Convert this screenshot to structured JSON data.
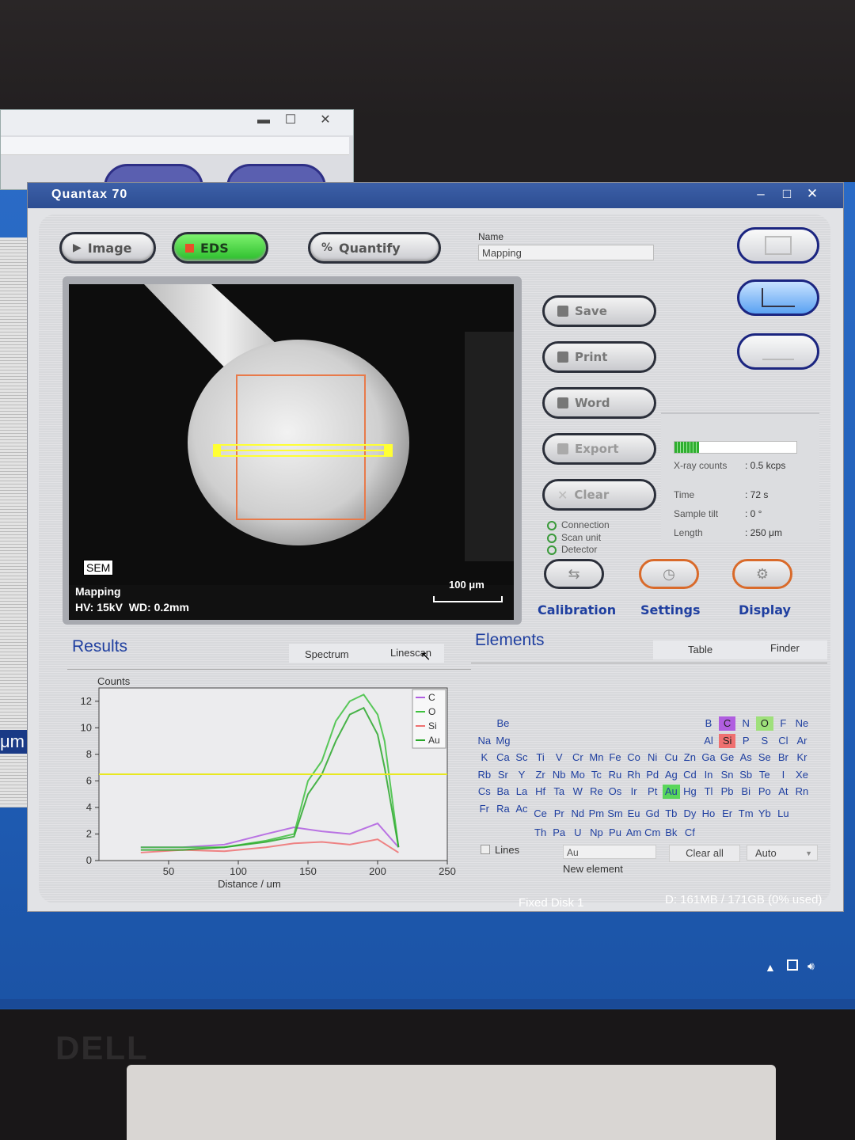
{
  "window": {
    "title": "Quantax 70",
    "min": "–",
    "max": "□",
    "close": "✕"
  },
  "back_window": {
    "min": "▬",
    "max": "☐",
    "close": "✕"
  },
  "left_strip": {
    "unit": "μm"
  },
  "mode_buttons": [
    {
      "label": "Image",
      "icon": "play-triangle-icon"
    },
    {
      "label": "EDS",
      "icon": "stop-square-icon"
    },
    {
      "label": "Quantify",
      "icon": "percent-icon"
    }
  ],
  "name_field": {
    "label": "Name",
    "value": "Mapping"
  },
  "sem_view": {
    "badge": "SEM",
    "mode": "Mapping",
    "params": "HV: 15kV  WD: 0.2mm",
    "scale_label": "100 μm"
  },
  "actions": [
    {
      "label": "Save",
      "icon": "floppy-icon"
    },
    {
      "label": "Print",
      "icon": "printer-icon"
    },
    {
      "label": "Word",
      "icon": "word-doc-icon"
    },
    {
      "label": "Export",
      "icon": "export-icon"
    },
    {
      "label": "Clear",
      "icon": "clear-x-icon"
    }
  ],
  "status": {
    "items": [
      "Connection",
      "Scan unit",
      "Detector"
    ]
  },
  "acquisition": {
    "progress": 0.2,
    "rows": [
      {
        "label": "X-ray counts",
        "value": ": 0.5 kcps"
      },
      {
        "label": "Time",
        "value": ": 72 s"
      },
      {
        "label": "Sample tilt",
        "value": ": 0 °"
      },
      {
        "label": "Length",
        "value": ": 250 μm"
      }
    ]
  },
  "bottom_tools": [
    {
      "label": "Calibration",
      "icon": "calibration-icon"
    },
    {
      "label": "Settings",
      "icon": "clock-icon"
    },
    {
      "label": "Display",
      "icon": "gear-icon"
    }
  ],
  "results": {
    "title": "Results",
    "tabs": [
      "Spectrum",
      "Linescan"
    ]
  },
  "elements_panel": {
    "title": "Elements",
    "tabs": [
      "Table",
      "Finder"
    ],
    "lines_label": "Lines",
    "element_input": "Au",
    "new_element": "New element",
    "clear_all": "Clear all",
    "auto": "Auto"
  },
  "taskbar": {
    "disk": "Fixed Disk 1",
    "usage": "D: 161MB / 171GB (0% used)"
  },
  "colors": {
    "accent_blue": "#1f3fa0",
    "eds_green": "#29bc2a",
    "C": "#b05ee0",
    "O": "#9fe07b",
    "Si": "#ef7070",
    "Au": "#59d65a"
  },
  "chart_data": {
    "type": "line",
    "xlabel": "Distance / μm",
    "ylabel": "Counts",
    "xlim": [
      0,
      250
    ],
    "ylim": [
      0,
      13
    ],
    "xticks": [
      50,
      100,
      150,
      200,
      250
    ],
    "yticks": [
      0,
      2,
      4,
      6,
      8,
      10,
      12
    ],
    "legend": {
      "placement": "top-right",
      "entries": [
        "C",
        "O",
        "Si",
        "Au"
      ]
    },
    "marker_line_y": 6.5,
    "series": [
      {
        "name": "C",
        "x": [
          30,
          60,
          90,
          120,
          140,
          160,
          180,
          200,
          215
        ],
        "values": [
          1,
          1,
          1.2,
          2,
          2.5,
          2.2,
          2,
          2.8,
          1
        ]
      },
      {
        "name": "O",
        "x": [
          30,
          60,
          90,
          120,
          140,
          150,
          160,
          170,
          180,
          190,
          200,
          205,
          215
        ],
        "values": [
          1,
          1,
          1,
          1.5,
          2,
          6,
          7.5,
          10.5,
          12,
          12.5,
          11,
          9,
          1
        ]
      },
      {
        "name": "Si",
        "x": [
          30,
          60,
          90,
          120,
          140,
          160,
          180,
          200,
          215
        ],
        "values": [
          0.6,
          0.8,
          0.7,
          1,
          1.3,
          1.4,
          1.2,
          1.6,
          0.6
        ]
      },
      {
        "name": "Au",
        "x": [
          30,
          60,
          90,
          120,
          140,
          150,
          160,
          170,
          180,
          190,
          200,
          205,
          215
        ],
        "values": [
          0.8,
          0.8,
          1,
          1.4,
          1.8,
          5,
          6.5,
          9,
          11,
          11.5,
          9.5,
          7,
          1
        ]
      }
    ]
  },
  "periodic": [
    {
      "s": "Be",
      "c": 1,
      "r": 1
    },
    {
      "s": "B",
      "c": 12,
      "r": 1
    },
    {
      "s": "C",
      "c": 13,
      "r": 1,
      "hl": "purple"
    },
    {
      "s": "N",
      "c": 14,
      "r": 1
    },
    {
      "s": "O",
      "c": 15,
      "r": 1,
      "hl": "green"
    },
    {
      "s": "F",
      "c": 16,
      "r": 1
    },
    {
      "s": "Ne",
      "c": 17,
      "r": 1
    },
    {
      "s": "Na",
      "c": 0,
      "r": 2
    },
    {
      "s": "Mg",
      "c": 1,
      "r": 2
    },
    {
      "s": "Al",
      "c": 12,
      "r": 2
    },
    {
      "s": "Si",
      "c": 13,
      "r": 2,
      "hl": "red"
    },
    {
      "s": "P",
      "c": 14,
      "r": 2
    },
    {
      "s": "S",
      "c": 15,
      "r": 2
    },
    {
      "s": "Cl",
      "c": 16,
      "r": 2
    },
    {
      "s": "Ar",
      "c": 17,
      "r": 2
    },
    {
      "s": "K",
      "c": 0,
      "r": 3
    },
    {
      "s": "Ca",
      "c": 1,
      "r": 3
    },
    {
      "s": "Sc",
      "c": 2,
      "r": 3
    },
    {
      "s": "Ti",
      "c": 3,
      "r": 3
    },
    {
      "s": "V",
      "c": 4,
      "r": 3
    },
    {
      "s": "Cr",
      "c": 5,
      "r": 3
    },
    {
      "s": "Mn",
      "c": 6,
      "r": 3
    },
    {
      "s": "Fe",
      "c": 7,
      "r": 3
    },
    {
      "s": "Co",
      "c": 8,
      "r": 3
    },
    {
      "s": "Ni",
      "c": 9,
      "r": 3
    },
    {
      "s": "Cu",
      "c": 10,
      "r": 3
    },
    {
      "s": "Zn",
      "c": 11,
      "r": 3
    },
    {
      "s": "Ga",
      "c": 12,
      "r": 3
    },
    {
      "s": "Ge",
      "c": 13,
      "r": 3
    },
    {
      "s": "As",
      "c": 14,
      "r": 3
    },
    {
      "s": "Se",
      "c": 15,
      "r": 3
    },
    {
      "s": "Br",
      "c": 16,
      "r": 3
    },
    {
      "s": "Kr",
      "c": 17,
      "r": 3
    },
    {
      "s": "Rb",
      "c": 0,
      "r": 4
    },
    {
      "s": "Sr",
      "c": 1,
      "r": 4
    },
    {
      "s": "Y",
      "c": 2,
      "r": 4
    },
    {
      "s": "Zr",
      "c": 3,
      "r": 4
    },
    {
      "s": "Nb",
      "c": 4,
      "r": 4
    },
    {
      "s": "Mo",
      "c": 5,
      "r": 4
    },
    {
      "s": "Tc",
      "c": 6,
      "r": 4
    },
    {
      "s": "Ru",
      "c": 7,
      "r": 4
    },
    {
      "s": "Rh",
      "c": 8,
      "r": 4
    },
    {
      "s": "Pd",
      "c": 9,
      "r": 4
    },
    {
      "s": "Ag",
      "c": 10,
      "r": 4
    },
    {
      "s": "Cd",
      "c": 11,
      "r": 4
    },
    {
      "s": "In",
      "c": 12,
      "r": 4
    },
    {
      "s": "Sn",
      "c": 13,
      "r": 4
    },
    {
      "s": "Sb",
      "c": 14,
      "r": 4
    },
    {
      "s": "Te",
      "c": 15,
      "r": 4
    },
    {
      "s": "I",
      "c": 16,
      "r": 4
    },
    {
      "s": "Xe",
      "c": 17,
      "r": 4
    },
    {
      "s": "Cs",
      "c": 0,
      "r": 5
    },
    {
      "s": "Ba",
      "c": 1,
      "r": 5
    },
    {
      "s": "La",
      "c": 2,
      "r": 5
    },
    {
      "s": "Hf",
      "c": 3,
      "r": 5
    },
    {
      "s": "Ta",
      "c": 4,
      "r": 5
    },
    {
      "s": "W",
      "c": 5,
      "r": 5
    },
    {
      "s": "Re",
      "c": 6,
      "r": 5
    },
    {
      "s": "Os",
      "c": 7,
      "r": 5
    },
    {
      "s": "Ir",
      "c": 8,
      "r": 5
    },
    {
      "s": "Pt",
      "c": 9,
      "r": 5
    },
    {
      "s": "Au",
      "c": 10,
      "r": 5,
      "hl": "green2"
    },
    {
      "s": "Hg",
      "c": 11,
      "r": 5
    },
    {
      "s": "Tl",
      "c": 12,
      "r": 5
    },
    {
      "s": "Pb",
      "c": 13,
      "r": 5
    },
    {
      "s": "Bi",
      "c": 14,
      "r": 5
    },
    {
      "s": "Po",
      "c": 15,
      "r": 5
    },
    {
      "s": "At",
      "c": 16,
      "r": 5
    },
    {
      "s": "Rn",
      "c": 17,
      "r": 5
    },
    {
      "s": "Fr",
      "c": 0,
      "r": 6
    },
    {
      "s": "Ra",
      "c": 1,
      "r": 6
    },
    {
      "s": "Ac",
      "c": 2,
      "r": 6
    },
    {
      "s": "Ce",
      "c": 3,
      "r": 6.3
    },
    {
      "s": "Pr",
      "c": 4,
      "r": 6.3
    },
    {
      "s": "Nd",
      "c": 5,
      "r": 6.3
    },
    {
      "s": "Pm",
      "c": 6,
      "r": 6.3
    },
    {
      "s": "Sm",
      "c": 7,
      "r": 6.3
    },
    {
      "s": "Eu",
      "c": 8,
      "r": 6.3
    },
    {
      "s": "Gd",
      "c": 9,
      "r": 6.3
    },
    {
      "s": "Tb",
      "c": 10,
      "r": 6.3
    },
    {
      "s": "Dy",
      "c": 11,
      "r": 6.3
    },
    {
      "s": "Ho",
      "c": 12,
      "r": 6.3
    },
    {
      "s": "Er",
      "c": 13,
      "r": 6.3
    },
    {
      "s": "Tm",
      "c": 14,
      "r": 6.3
    },
    {
      "s": "Yb",
      "c": 15,
      "r": 6.3
    },
    {
      "s": "Lu",
      "c": 16,
      "r": 6.3
    },
    {
      "s": "Th",
      "c": 3,
      "r": 7.4
    },
    {
      "s": "Pa",
      "c": 4,
      "r": 7.4
    },
    {
      "s": "U",
      "c": 5,
      "r": 7.4
    },
    {
      "s": "Np",
      "c": 6,
      "r": 7.4
    },
    {
      "s": "Pu",
      "c": 7,
      "r": 7.4
    },
    {
      "s": "Am",
      "c": 8,
      "r": 7.4
    },
    {
      "s": "Cm",
      "c": 9,
      "r": 7.4
    },
    {
      "s": "Bk",
      "c": 10,
      "r": 7.4
    },
    {
      "s": "Cf",
      "c": 11,
      "r": 7.4
    }
  ]
}
